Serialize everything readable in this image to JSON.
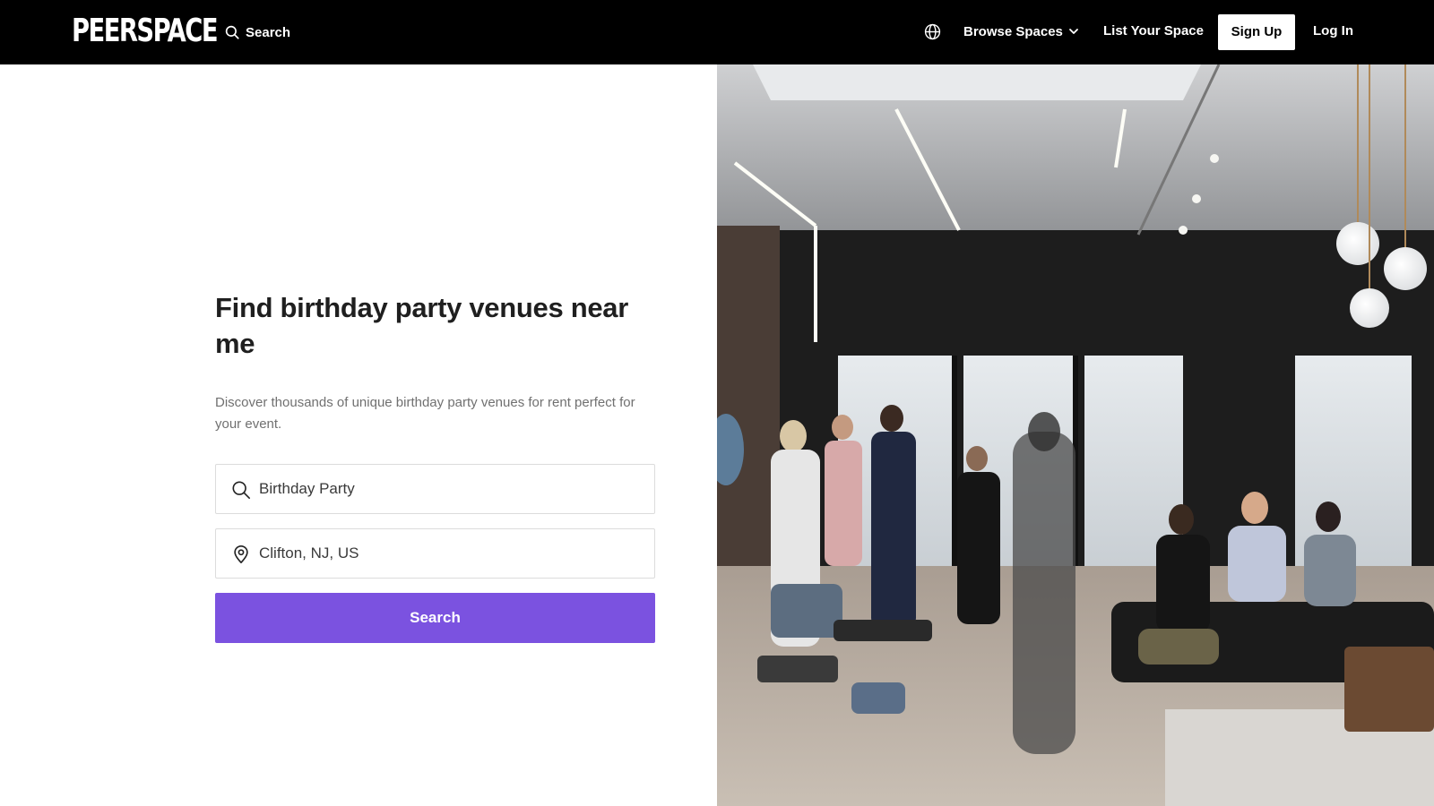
{
  "nav": {
    "logo": "PEERSPACE",
    "search_label": "Search",
    "language_icon": "globe-icon",
    "browse_label": "Browse Spaces",
    "list_label": "List Your Space",
    "signup_label": "Sign Up",
    "login_label": "Log In"
  },
  "hero": {
    "title": "Find birthday party venues near me",
    "subtitle": "Discover thousands of unique birthday party venues for rent perfect for your event.",
    "activity_value": "Birthday Party",
    "location_value": "Clifton, NJ, US",
    "search_button": "Search"
  },
  "photo": {
    "subject": "people mingling in a loft event space"
  },
  "colors": {
    "nav_bg": "#000000",
    "accent": "#7b52e0",
    "text": "#1f1f1f",
    "muted": "#707070"
  }
}
